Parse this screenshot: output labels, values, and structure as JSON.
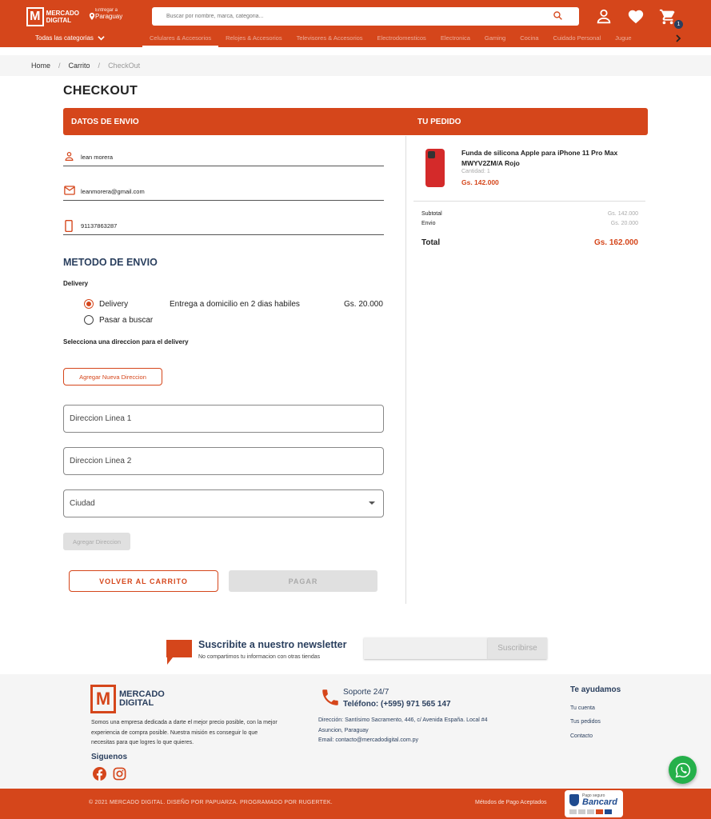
{
  "header": {
    "logo_line1": "MERCADO",
    "logo_line2": "DIGITAL",
    "deliver_label": "Entregar a",
    "deliver_location": "Paraguay",
    "search_placeholder": "Buscar por nombre, marca, categoria...",
    "cart_count": "1",
    "all_categories": "Todas las categorias",
    "nav": [
      "Celulares & Accesorios",
      "Relojes & Accesorios",
      "Televisores & Accesorios",
      "Electrodomesticos",
      "Electronica",
      "Gaming",
      "Cocina",
      "Cuidado Personal",
      "Jugue"
    ]
  },
  "breadcrumb": {
    "home": "Home",
    "cart": "Carrito",
    "current": "CheckOut",
    "sep": "/"
  },
  "page_title": "CHECKOUT",
  "bar": {
    "left": "DATOS DE ENVIO",
    "right": "TU PEDIDO"
  },
  "form": {
    "name": "lean morera",
    "email": "leanmorera@gmail.com",
    "phone": "91137863287"
  },
  "shipping": {
    "title": "METODO DE ENVIO",
    "section_label": "Delivery",
    "option1": "Delivery",
    "option1_desc": "Entrega a domicilio en 2 dias habiles",
    "option1_price": "Gs. 20.000",
    "option2": "Pasar a buscar",
    "select_address_label": "Selecciona una direccion para el delivery",
    "add_address": "Agregar Nueva Direccion",
    "line1": "Direccion Linea 1",
    "line2": "Direccion Linea 2",
    "city": "Ciudad",
    "add_btn": "Agregar Direccion"
  },
  "actions": {
    "back": "VOLVER AL CARRITO",
    "pay": "PAGAR"
  },
  "order": {
    "product_name": "Funda de silicona Apple para iPhone 11 Pro Max MWYV2ZM/A Rojo",
    "qty": "Cantidad: 1",
    "price": "Gs. 142.000",
    "subtotal_label": "Subtotal",
    "subtotal": "Gs. 142.000",
    "shipping_label": "Envio",
    "shipping": "Gs. 20.000",
    "total_label": "Total",
    "total": "Gs. 162.000"
  },
  "newsletter": {
    "title": "Suscribite a nuestro newsletter",
    "subtitle": "No compartimos tu informacion con otras tiendas",
    "button": "Suscribirse"
  },
  "footer": {
    "desc": "Somos una empresa dedicada a darte el mejor precio posible, con la mejor experiencia de compra posible. Nuestra misión es conseguir lo que necesitas para que logres lo que quieres.",
    "follow": "Siguenos",
    "support": "Soporte 24/7",
    "phone": "Teléfono: (+595) 971 565 147",
    "address1": "Dirección: Santísimo Sacramento, 446, c/ Avenida España. Local #4",
    "address2": "Asuncion, Paraguay",
    "email": "Email: contacto@mercadodigital.com.py",
    "help_title": "Te ayudamos",
    "links": [
      "Tu cuenta",
      "Tus pedidos",
      "Contacto"
    ],
    "copyright": "© 2021 MERCADO DIGITAL. DISEÑO POR PAPUARZA. PROGRAMADO POR RUGERTEK.",
    "payment": "Métodos de Pago Aceptados",
    "bancard_top": "Pago seguro",
    "bancard": "Bancard"
  },
  "colors": {
    "accent": "#d5461b",
    "navy": "#2a3f5e"
  }
}
